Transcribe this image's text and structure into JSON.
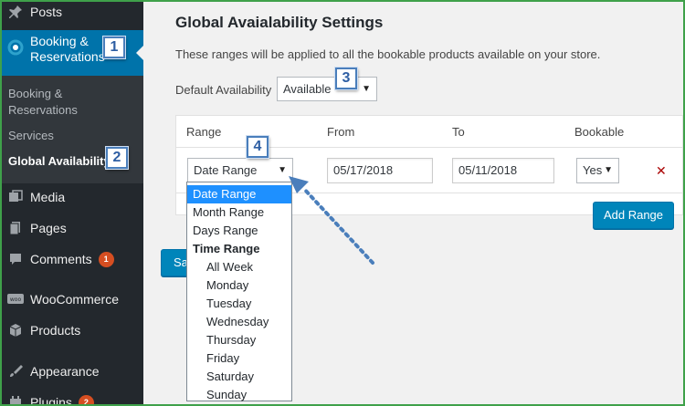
{
  "sidebar": {
    "posts": "Posts",
    "booking_reservations": "Booking & Reservations",
    "sub_items": [
      "Booking & Reservations",
      "Services",
      "Global Availability"
    ],
    "media": "Media",
    "pages": "Pages",
    "comments": "Comments",
    "comments_badge": "1",
    "woocommerce": "WooCommerce",
    "products": "Products",
    "appearance": "Appearance",
    "plugins": "Plugins",
    "plugins_badge": "2"
  },
  "annotations": [
    "1",
    "2",
    "3",
    "4"
  ],
  "main": {
    "title": "Global Avaialability Settings",
    "description": "These ranges will be applied to all the bookable products available on your store.",
    "default_availability_label": "Default Availability",
    "default_availability_value": "Available",
    "table": {
      "headers": [
        "Range",
        "From",
        "To",
        "Bookable"
      ],
      "row": {
        "range": "Date Range",
        "from": "05/17/2018",
        "to": "05/11/2018",
        "bookable": "Yes",
        "remove": "✕"
      }
    },
    "add_range_button": "Add Range",
    "save_button_partial": "Sa"
  },
  "range_dropdown": {
    "options": [
      "Date Range",
      "Month Range",
      "Days Range"
    ],
    "group_label": "Time Range",
    "group_options": [
      "All Week",
      "Monday",
      "Tuesday",
      "Wednesday",
      "Thursday",
      "Friday",
      "Saturday",
      "Sunday"
    ],
    "selected": "Date Range"
  },
  "colors": {
    "sidebar_bg": "#23282d",
    "submenu_bg": "#32373c",
    "active_blue": "#0073aa",
    "button_blue": "#0085ba",
    "badge_orange": "#d54e21",
    "frame_green": "#3fa14a",
    "annotation_blue": "#4a7ebb",
    "option_highlight": "#1e90ff"
  },
  "icons": [
    "pin-icon",
    "booking-icon",
    "media-icon",
    "pages-icon",
    "comments-icon",
    "woocommerce-icon",
    "products-icon",
    "appearance-icon",
    "plugins-icon",
    "remove-icon"
  ]
}
